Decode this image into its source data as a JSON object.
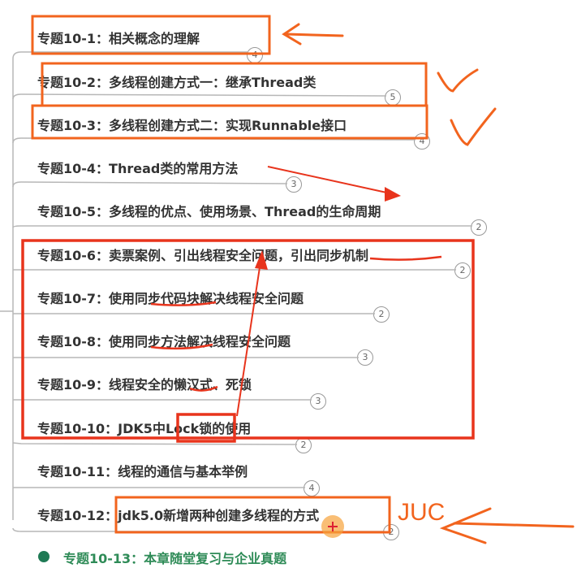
{
  "topics": [
    {
      "label": "专题10-1：相关概念的理解",
      "count": "4"
    },
    {
      "label": "专题10-2：多线程创建方式一：继承Thread类",
      "count": "5"
    },
    {
      "label": "专题10-3：多线程创建方式二：实现Runnable接口",
      "count": "4"
    },
    {
      "label": "专题10-4：Thread类的常用方法",
      "count": "3"
    },
    {
      "label": "专题10-5：多线程的优点、使用场景、Thread的生命周期",
      "count": "2"
    },
    {
      "label": "专题10-6：卖票案例、引出线程安全问题，引出同步机制",
      "count": "2"
    },
    {
      "label": "专题10-7：使用同步代码块解决线程安全问题",
      "count": "2"
    },
    {
      "label": "专题10-8：使用同步方法解决线程安全问题",
      "count": "3"
    },
    {
      "label": "专题10-9：线程安全的懒汉式、死锁",
      "count": "3"
    },
    {
      "label": "专题10-10：JDK5中Lock锁的使用",
      "count": "2"
    },
    {
      "label": "专题10-11：线程的通信与基本举例",
      "count": "4"
    },
    {
      "label": "专题10-12：jdk5.0新增两种创建多线程的方式",
      "count": "2"
    },
    {
      "label": "专题10-13：本章随堂复习与企业真题"
    }
  ],
  "annotation": {
    "juc_label": "JUC"
  },
  "colors": {
    "annotation_red": "#e8341c",
    "annotation_orange": "#f2641e",
    "topic_text": "#333333",
    "topic_13_green": "#2e8b57"
  }
}
